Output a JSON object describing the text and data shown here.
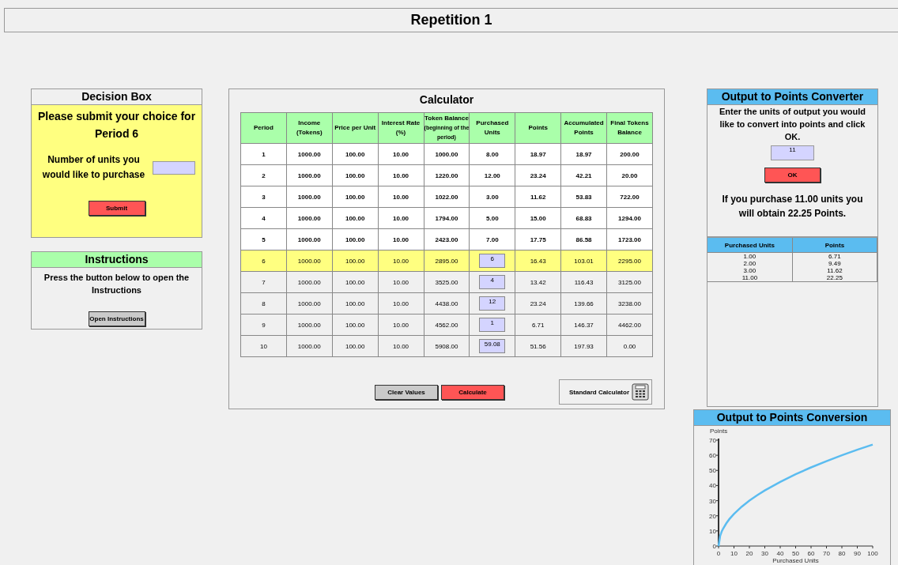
{
  "window": {
    "title": "Repetition 1"
  },
  "decision_box": {
    "title": "Decision Box",
    "prompt": "Please submit your choice for Period 6",
    "label": "Number of units you would like to purchase",
    "button": "Submit"
  },
  "instructions": {
    "title": "Instructions",
    "text": "Press the button below to open the Instructions",
    "button": "Open Instructions"
  },
  "calculator": {
    "title": "Calculator",
    "columns": [
      {
        "label": "Period"
      },
      {
        "label": "Income (Tokens)"
      },
      {
        "label": "Price per Unit"
      },
      {
        "label": "Interest Rate (%)"
      },
      {
        "label": "Token Balance",
        "note": "(beginning of the period)"
      },
      {
        "label": "Purchased Units"
      },
      {
        "label": "Points"
      },
      {
        "label": "Accumulated Points"
      },
      {
        "label": "Final Tokens Balance"
      }
    ],
    "rows": [
      {
        "kind": "past",
        "cells": [
          "1",
          "1000.00",
          "100.00",
          "10.00",
          "1000.00",
          "8.00",
          "18.97",
          "18.97",
          "200.00"
        ]
      },
      {
        "kind": "past",
        "cells": [
          "2",
          "1000.00",
          "100.00",
          "10.00",
          "1220.00",
          "12.00",
          "23.24",
          "42.21",
          "20.00"
        ]
      },
      {
        "kind": "past",
        "cells": [
          "3",
          "1000.00",
          "100.00",
          "10.00",
          "1022.00",
          "3.00",
          "11.62",
          "53.83",
          "722.00"
        ]
      },
      {
        "kind": "past",
        "cells": [
          "4",
          "1000.00",
          "100.00",
          "10.00",
          "1794.00",
          "5.00",
          "15.00",
          "68.83",
          "1294.00"
        ]
      },
      {
        "kind": "past",
        "cells": [
          "5",
          "1000.00",
          "100.00",
          "10.00",
          "2423.00",
          "7.00",
          "17.75",
          "86.58",
          "1723.00"
        ]
      },
      {
        "kind": "current",
        "cells": [
          "6",
          "1000.00",
          "100.00",
          "10.00",
          "2895.00",
          "6",
          "16.43",
          "103.01",
          "2295.00"
        ]
      },
      {
        "kind": "planned",
        "cells": [
          "7",
          "1000.00",
          "100.00",
          "10.00",
          "3525.00",
          "4",
          "13.42",
          "116.43",
          "3125.00"
        ]
      },
      {
        "kind": "planned",
        "cells": [
          "8",
          "1000.00",
          "100.00",
          "10.00",
          "4438.00",
          "12",
          "23.24",
          "139.66",
          "3238.00"
        ]
      },
      {
        "kind": "planned",
        "cells": [
          "9",
          "1000.00",
          "100.00",
          "10.00",
          "4562.00",
          "1",
          "6.71",
          "146.37",
          "4462.00"
        ]
      },
      {
        "kind": "planned",
        "cells": [
          "10",
          "1000.00",
          "100.00",
          "10.00",
          "5908.00",
          "59.08",
          "51.56",
          "197.93",
          "0.00"
        ]
      }
    ],
    "buttons": [
      {
        "label": "Clear Values",
        "kind": "neutral"
      },
      {
        "label": "Calculate",
        "kind": "primary"
      }
    ],
    "standard_calculator": "Standard Calculator"
  },
  "converter": {
    "title": "Output to Points Converter",
    "text": "Enter the units of output you would like to convert into points and click OK.",
    "value": "11",
    "button": "OK",
    "result": "If you purchase 11.00 units you will obtain 22.25 Points.",
    "table": {
      "columns": [
        "Purchased Units",
        "Points"
      ],
      "rows": [
        [
          "1.00",
          "6.71"
        ],
        [
          "2.00",
          "9.49"
        ],
        [
          "3.00",
          "11.62"
        ],
        [
          "11.00",
          "22.25"
        ]
      ]
    }
  },
  "conversion": {
    "title": "Output to Points Conversion",
    "chart_data": {
      "type": "line",
      "xlabel": "Purchased Units",
      "ylabel": "Points",
      "x": [
        0,
        1,
        2,
        3,
        5,
        7,
        10,
        15,
        20,
        25,
        30,
        40,
        50,
        60,
        70,
        80,
        90,
        100
      ],
      "series": [
        {
          "color": "#5bbcf0",
          "values": [
            0,
            6.7,
            9.5,
            11.6,
            15,
            17.8,
            21.2,
            26,
            30,
            33.6,
            36.8,
            42.4,
            47.5,
            52,
            56.1,
            60,
            63.7,
            67.1
          ]
        }
      ],
      "xlim": [
        0,
        100
      ],
      "ylim": [
        0,
        70
      ],
      "xticks": [
        0,
        10,
        20,
        30,
        40,
        50,
        60,
        70,
        80,
        90,
        100
      ],
      "yticks": [
        0,
        10,
        20,
        30,
        40,
        50,
        60,
        70
      ]
    }
  }
}
